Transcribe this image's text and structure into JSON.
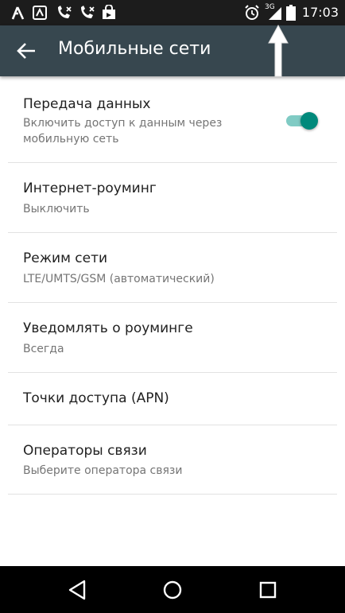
{
  "status_bar": {
    "time": "17:03",
    "network_label": "3G",
    "icons": [
      "lambda-icon",
      "notification-icon",
      "missed-call-icon",
      "missed-call-icon",
      "shopping-bag-icon",
      "alarm-icon",
      "signal-icon",
      "battery-icon"
    ]
  },
  "app_bar": {
    "title": "Мобильные сети",
    "back_icon": "arrow-back-icon"
  },
  "settings": {
    "items": [
      {
        "title": "Передача данных",
        "subtitle": "Включить доступ к данным через мобильную сеть",
        "toggle_on": true
      },
      {
        "title": "Интернет-роуминг",
        "subtitle": "Выключить"
      },
      {
        "title": "Режим сети",
        "subtitle": "LTE/UMTS/GSM (автоматический)"
      },
      {
        "title": "Уведомлять о роуминге",
        "subtitle": "Всегда"
      },
      {
        "title": "Точки доступа (APN)"
      },
      {
        "title": "Операторы связи",
        "subtitle": "Выберите оператора связи"
      }
    ]
  },
  "nav_bar": {
    "icons": [
      "back-triangle-icon",
      "home-circle-icon",
      "recents-square-icon"
    ]
  },
  "colors": {
    "status_bar": "#1c1c1c",
    "app_bar": "#37474f",
    "toggle_thumb": "#00897b",
    "toggle_track": "#80cbc4"
  }
}
